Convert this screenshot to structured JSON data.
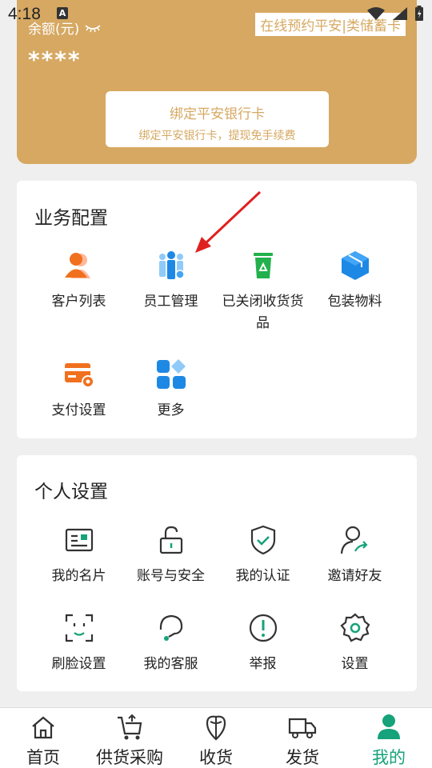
{
  "status_bar": {
    "time": "4:18",
    "notification_letter": "A"
  },
  "balance": {
    "label": "余额(元)",
    "amount": "****",
    "deposit_link": "在线预约平安|类储蓄卡",
    "bind_card_title": "绑定平安银行卡",
    "bind_card_subtitle": "绑定平安银行卡，提现免手续费"
  },
  "business": {
    "title": "业务配置",
    "items": [
      {
        "label": "客户列表",
        "icon": "customer-list-icon"
      },
      {
        "label": "员工管理",
        "icon": "staff-management-icon"
      },
      {
        "label": "已关闭收货货品",
        "icon": "recycle-bin-icon"
      },
      {
        "label": "包装物料",
        "icon": "package-box-icon"
      },
      {
        "label": "支付设置",
        "icon": "payment-card-icon"
      },
      {
        "label": "更多",
        "icon": "grid-more-icon"
      }
    ]
  },
  "personal": {
    "title": "个人设置",
    "items": [
      {
        "label": "我的名片",
        "icon": "business-card-icon"
      },
      {
        "label": "账号与安全",
        "icon": "unlock-icon"
      },
      {
        "label": "我的认证",
        "icon": "shield-check-icon"
      },
      {
        "label": "邀请好友",
        "icon": "invite-user-icon"
      },
      {
        "label": "刷脸设置",
        "icon": "face-scan-icon"
      },
      {
        "label": "我的客服",
        "icon": "headset-icon"
      },
      {
        "label": "举报",
        "icon": "exclamation-icon"
      },
      {
        "label": "设置",
        "icon": "gear-icon"
      }
    ]
  },
  "tabs": [
    {
      "label": "首页",
      "icon": "home-icon"
    },
    {
      "label": "供货采购",
      "icon": "cart-icon"
    },
    {
      "label": "收货",
      "icon": "produce-icon"
    },
    {
      "label": "发货",
      "icon": "truck-icon"
    },
    {
      "label": "我的",
      "icon": "user-icon",
      "active": true
    }
  ],
  "colors": {
    "gold": "#d6a862",
    "green": "#16a27a",
    "blue": "#1e88e5",
    "orange": "#f0701e"
  }
}
